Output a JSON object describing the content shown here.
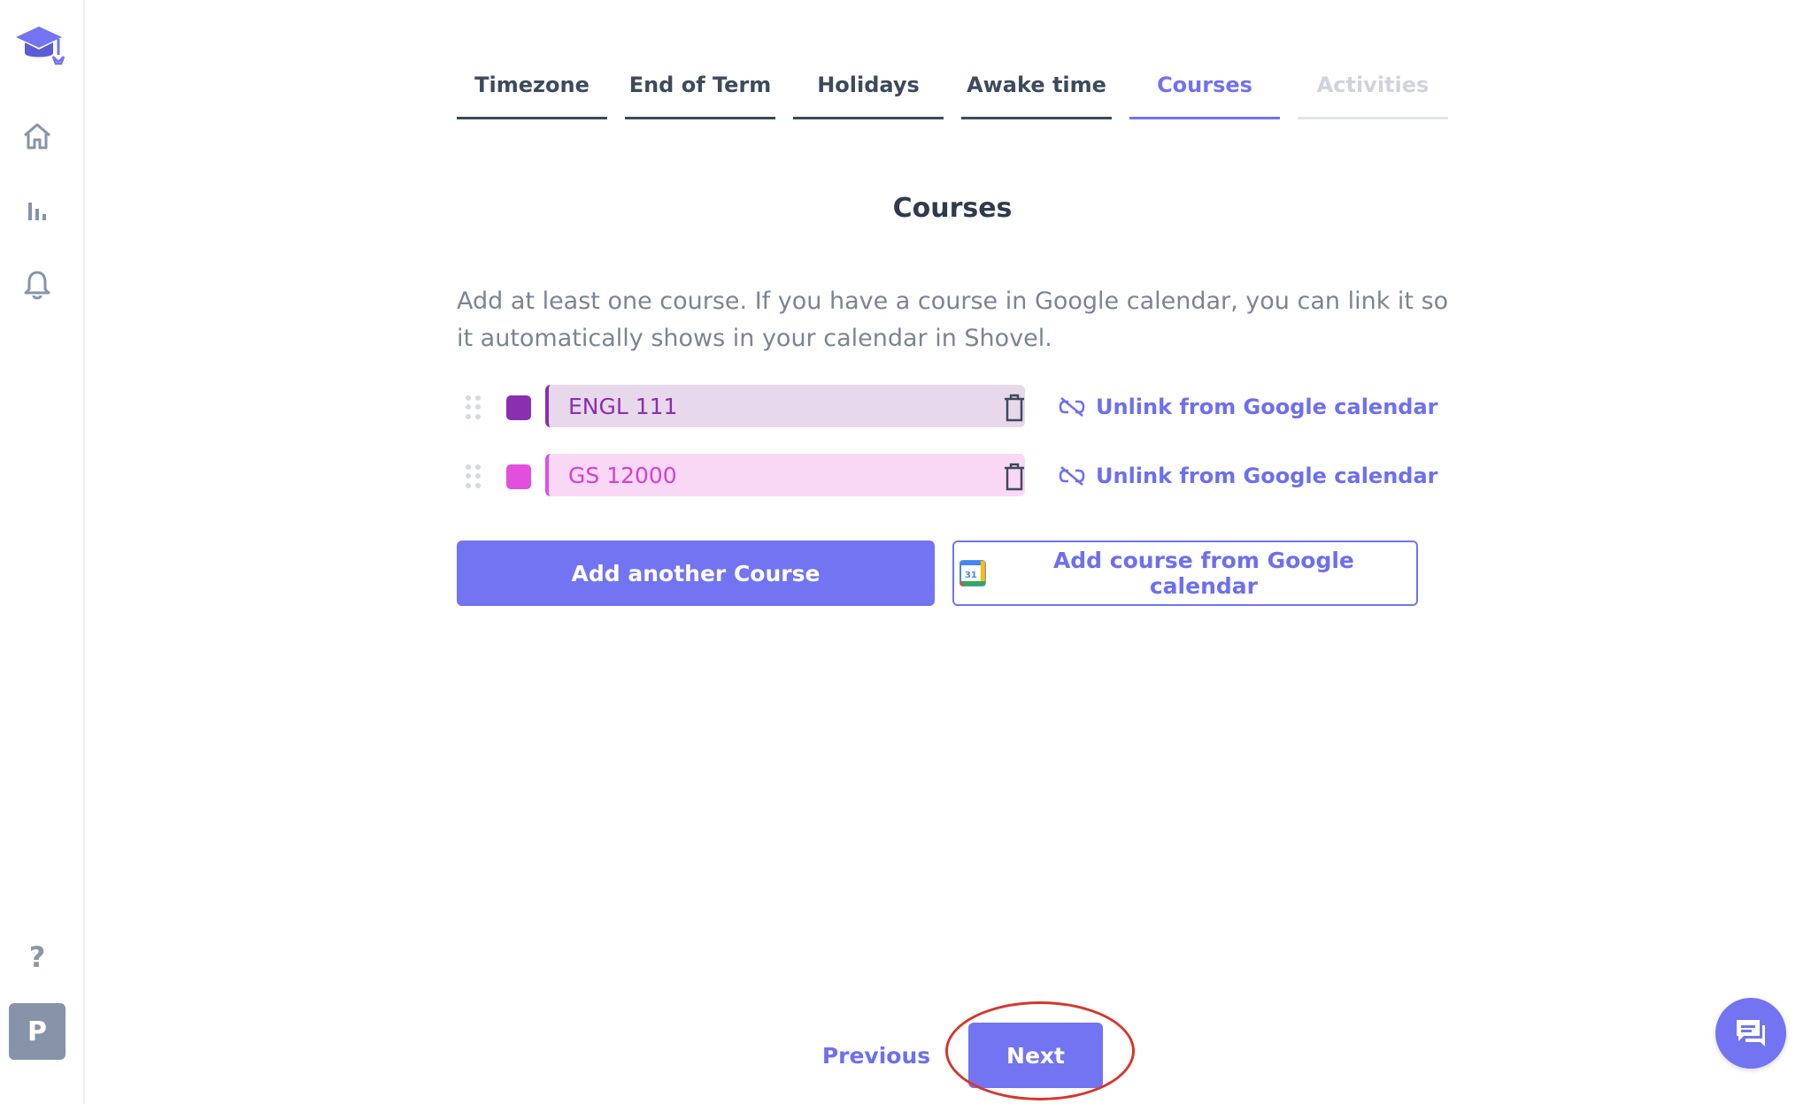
{
  "colors": {
    "accent": "#7274f1",
    "text_dark": "#3d4a5c",
    "text_muted": "#7b8494",
    "course1_color": "#8a2fb0",
    "course1_bg": "#e8d8ec",
    "course2_color": "#e24fdc",
    "course2_bg": "#f9d8f6",
    "annotation_ring": "#d7362b"
  },
  "sidebar": {
    "icons": [
      "graduation-cap-logo",
      "home-icon",
      "bar-chart-icon",
      "bell-icon",
      "help-icon"
    ],
    "help_label": "?",
    "avatar_initial": "P"
  },
  "tabs": [
    {
      "label": "Timezone",
      "state": "done"
    },
    {
      "label": "End of Term",
      "state": "done"
    },
    {
      "label": "Holidays",
      "state": "done"
    },
    {
      "label": "Awake time",
      "state": "done"
    },
    {
      "label": "Courses",
      "state": "active"
    },
    {
      "label": "Activities",
      "state": "disabled"
    }
  ],
  "main": {
    "title": "Courses",
    "description": "Add at least one course. If you have a course in Google calendar, you can link it so it automatically shows in your calendar in Shovel.",
    "courses": [
      {
        "name": "ENGL 111",
        "unlink_label": "Unlink from Google calendar"
      },
      {
        "name": "GS 12000",
        "unlink_label": "Unlink from Google calendar"
      }
    ],
    "add_course_label": "Add another Course",
    "add_google_label": "Add course from Google calendar",
    "google_icon_text": "31"
  },
  "footer": {
    "previous_label": "Previous",
    "next_label": "Next"
  }
}
